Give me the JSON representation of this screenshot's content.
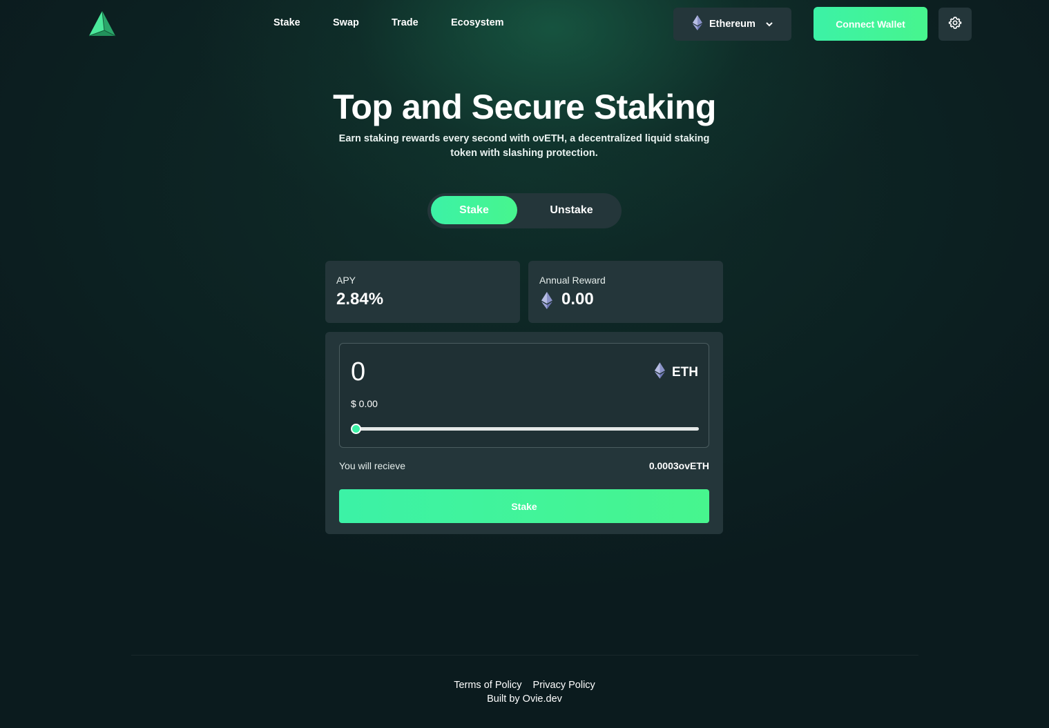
{
  "colors": {
    "accent": "#3cf2a6",
    "accent_end": "#47f58e",
    "card": "#24363a",
    "background": "#0b1b1e"
  },
  "header": {
    "logo_icon": "pyramid-logo",
    "nav": [
      "Stake",
      "Swap",
      "Trade",
      "Ecosystem"
    ],
    "network": {
      "icon": "ethereum-icon",
      "label": "Ethereum"
    },
    "connect_label": "Connect Wallet",
    "settings_icon": "gear-icon"
  },
  "hero": {
    "title": "Top and Secure Staking",
    "subtitle": "Earn staking rewards every second with ovETH, a decentralized liquid staking token with slashing protection."
  },
  "toggle": {
    "stake": "Stake",
    "unstake": "Unstake",
    "active": "Stake"
  },
  "stats": {
    "apy_label": "APY",
    "apy_value": "2.84%",
    "reward_label": "Annual Reward",
    "reward_value": "0.00"
  },
  "stake_form": {
    "amount": "0",
    "token": "ETH",
    "usd_value": "$ 0.00",
    "slider_fraction": 0,
    "receive_label": "You will recieve",
    "receive_value": "0.0003ovETH",
    "submit_label": "Stake"
  },
  "footer": {
    "terms": "Terms of Policy",
    "privacy": "Privacy Policy",
    "built_prefix": "Built by ",
    "built_link": "Ovie.dev"
  }
}
